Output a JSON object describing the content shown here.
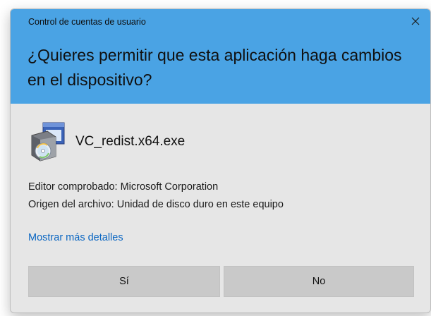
{
  "dialog": {
    "title": "Control de cuentas de usuario",
    "question": "¿Quieres permitir que esta aplicación haga cambios en el dispositivo?",
    "close_icon": "close-icon"
  },
  "app": {
    "icon": "installer-icon",
    "name": "VC_redist.x64.exe"
  },
  "info": {
    "publisher": "Editor comprobado: Microsoft Corporation",
    "origin": "Origen del archivo: Unidad de disco duro en este equipo"
  },
  "details_link": "Mostrar más detalles",
  "buttons": {
    "yes": "Sí",
    "no": "No"
  },
  "colors": {
    "header": "#4aa3e4",
    "body": "#e6e6e6",
    "button": "#c9c9c9",
    "link": "#0a66c2"
  }
}
